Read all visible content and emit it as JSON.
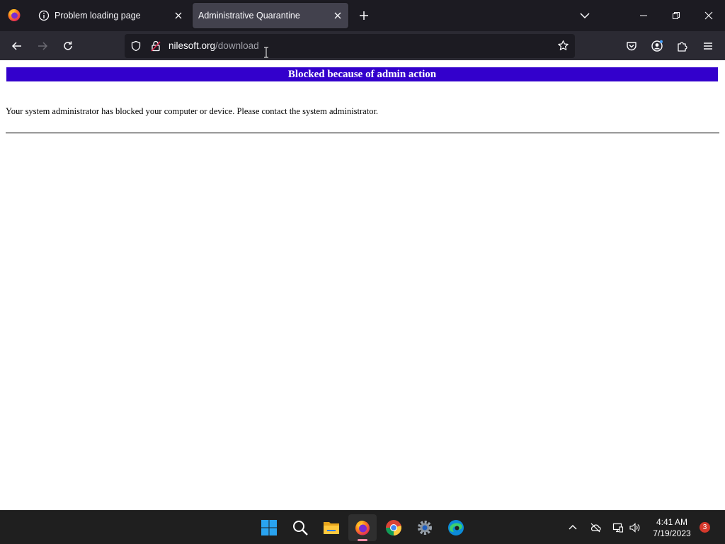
{
  "browser": {
    "tabs": [
      {
        "title": "Problem loading page",
        "icon": "info-icon",
        "active": false
      },
      {
        "title": "Administrative Quarantine",
        "icon": "none",
        "active": true
      }
    ],
    "url": {
      "domain": "nilesoft.org",
      "path": "/download"
    }
  },
  "page": {
    "banner_title": "Blocked because of admin action",
    "message": "Your system administrator has blocked your computer or device. Please contact the system administrator.",
    "banner_color": "#3300cc"
  },
  "taskbar": {
    "apps": [
      "start-icon",
      "search-icon",
      "file-explorer-icon",
      "firefox-icon",
      "chrome-icon",
      "settings-icon",
      "edge-icon"
    ],
    "active_app": "firefox-icon",
    "time": "4:41 AM",
    "date": "7/19/2023",
    "notification_count": "3"
  },
  "colors": {
    "tabstrip_bg": "#1c1b22",
    "navbar_bg": "#2b2a33",
    "active_tab_bg": "#42414d",
    "taskbar_bg": "#1f1f1f"
  }
}
